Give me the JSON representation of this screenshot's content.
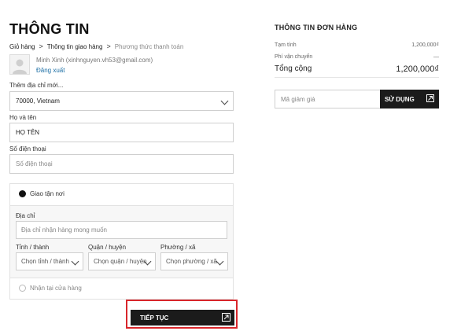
{
  "page": {
    "title": "THÔNG TIN"
  },
  "breadcrumb": [
    "Giỏ hàng",
    "Thông tin giao hàng",
    "Phương thức thanh toán"
  ],
  "account": {
    "name": "Minh Xinh (xinhnguyen.vh53@gmail.com)",
    "logout": "Đăng xuất"
  },
  "address_select": {
    "label": "Thêm địa chỉ mới...",
    "value": "70000, Vietnam"
  },
  "fullname": {
    "label": "Họ và tên",
    "value": "HỌ TÊN"
  },
  "phone": {
    "label": "Số điện thoại",
    "placeholder": "Số điện thoại"
  },
  "shipping": {
    "home_label": "Giao tận nơi",
    "address_label": "Địa chỉ",
    "address_placeholder": "Địa chỉ nhận hàng mong muốn",
    "province_label": "Tỉnh / thành",
    "province_value": "Chọn tỉnh / thành",
    "district_label": "Quận / huyện",
    "district_value": "Chọn quận / huyện",
    "ward_label": "Phường / xã",
    "ward_value": "Chọn phường / xã",
    "pickup_label": "Nhận tại cửa hàng"
  },
  "continue_label": "TIẾP TỤC",
  "order": {
    "title": "THÔNG TIN ĐƠN HÀNG",
    "subtotal_label": "Tạm tính",
    "subtotal_value": "1,200,000₫",
    "shipping_label": "Phí vận chuyển",
    "shipping_value": "—",
    "total_label": "Tổng cộng",
    "total_value": "1,200,000₫",
    "coupon_placeholder": "Mã giảm giá",
    "coupon_button": "SỬ DỤNG"
  }
}
